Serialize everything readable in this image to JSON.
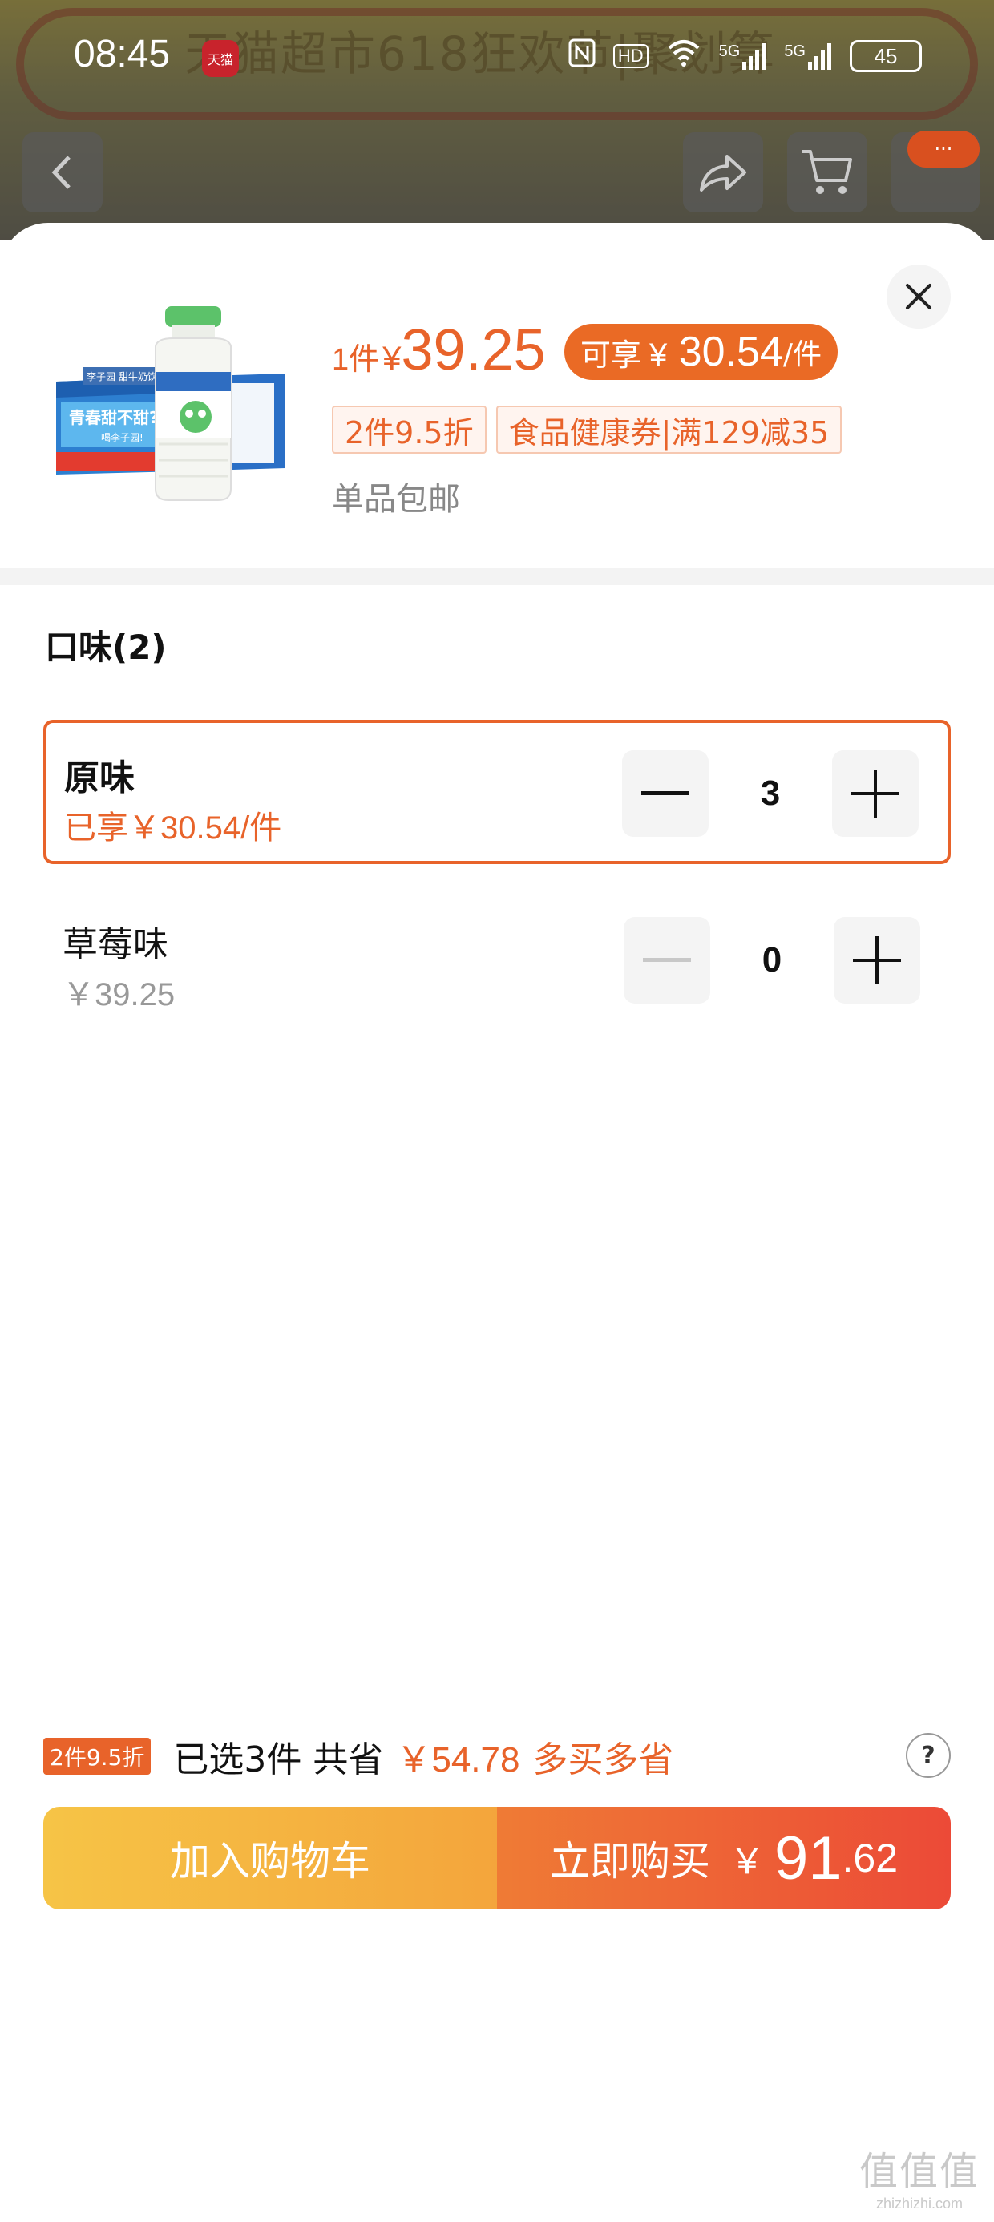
{
  "background": {
    "banner_text": "天猫超市618狂欢节|聚划算"
  },
  "statusbar": {
    "time": "08:45",
    "app_badge": "天猫",
    "net1": "5G",
    "net2": "5G",
    "hd": "HD",
    "battery": "45"
  },
  "nav": {
    "more_dots": "···"
  },
  "product": {
    "qty_label": "1件",
    "currency": "¥",
    "price": "39.25",
    "promo_label": "可享",
    "promo_currency": "¥",
    "promo_price": "30.54",
    "promo_unit": "/件",
    "tags": [
      "2件9.5折",
      "食品健康券|满129减35"
    ],
    "shipping": "单品包邮",
    "image_text_top": "李子园 甜牛奶饮品",
    "image_text_slogan": "青春甜不甜?",
    "image_text_sub": "喝李子园!"
  },
  "flavor_section": {
    "title": "口味(2)",
    "options": [
      {
        "name": "原味",
        "sub": "已享￥30.54/件",
        "qty": "3",
        "selected": true
      },
      {
        "name": "草莓味",
        "sub": "￥39.25",
        "qty": "0",
        "selected": false
      }
    ]
  },
  "summary": {
    "badge": "2件9.5折",
    "selected_text": "已选3件 共省",
    "saved": "￥54.78",
    "more_text": "多买多省",
    "help": "?"
  },
  "actions": {
    "add_to_cart": "加入购物车",
    "buy_now": "立即购买",
    "currency": "￥",
    "total_int": "91",
    "total_dec": ".62"
  },
  "watermark": {
    "logo": "值值值",
    "url": "zhizhizhi.com"
  },
  "colors": {
    "accent": "#e8632a",
    "buy_gradient_start": "#ef7b35",
    "buy_gradient_end": "#ec4a37",
    "cart_gradient_start": "#f6c446",
    "cart_gradient_end": "#f4a53c"
  }
}
